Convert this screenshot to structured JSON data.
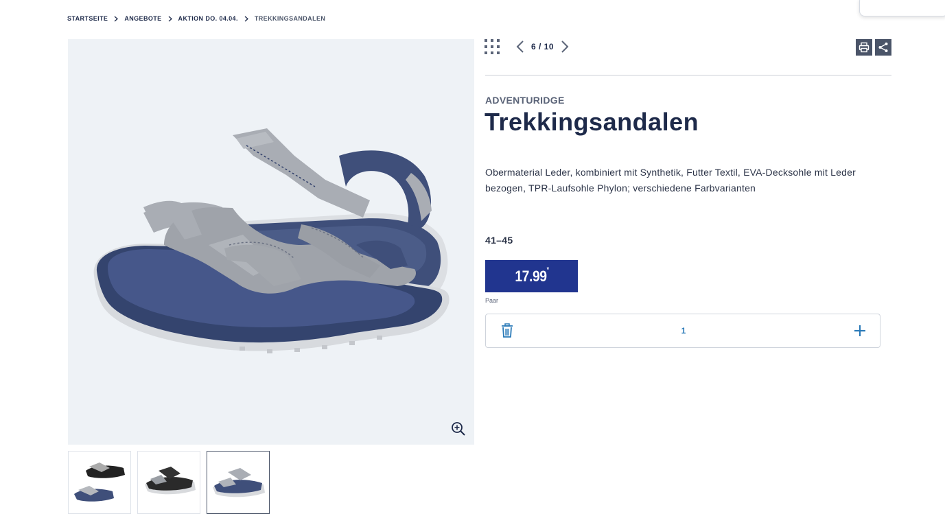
{
  "breadcrumb": [
    "STARTSEITE",
    "ANGEBOTE",
    "AKTION DO. 04.04.",
    "TREKKINGSANDALEN"
  ],
  "pager": {
    "counter": "6 / 10"
  },
  "product": {
    "brand": "ADVENTURIDGE",
    "title": "Trekkingsandalen",
    "description": "Obermaterial Leder, kombiniert mit Synthetik, Futter Textil, EVA-Decksohle mit Leder bezogen, TPR-Laufsohle Phylon; verschiedene Farbvarianten",
    "size": "41–45",
    "price": "17.99",
    "price_mark": "*",
    "unit": "Paar"
  },
  "quantity": {
    "value": "1"
  },
  "thumbnails": [
    "black-grey-and-blue-grey",
    "black-grey",
    "blue-grey"
  ],
  "active_thumbnail": 2,
  "icons": {
    "grid": "grid-icon",
    "prev": "chevron-left-icon",
    "next": "chevron-right-icon",
    "print": "print-icon",
    "share": "share-icon",
    "zoom": "zoom-in-icon",
    "delete": "trash-icon",
    "add": "plus-icon"
  },
  "colors": {
    "brand_blue": "#21358f",
    "navy_text": "#1e2a4a",
    "action_blue": "#2a7ab8",
    "icon_grey": "#4a5468"
  }
}
